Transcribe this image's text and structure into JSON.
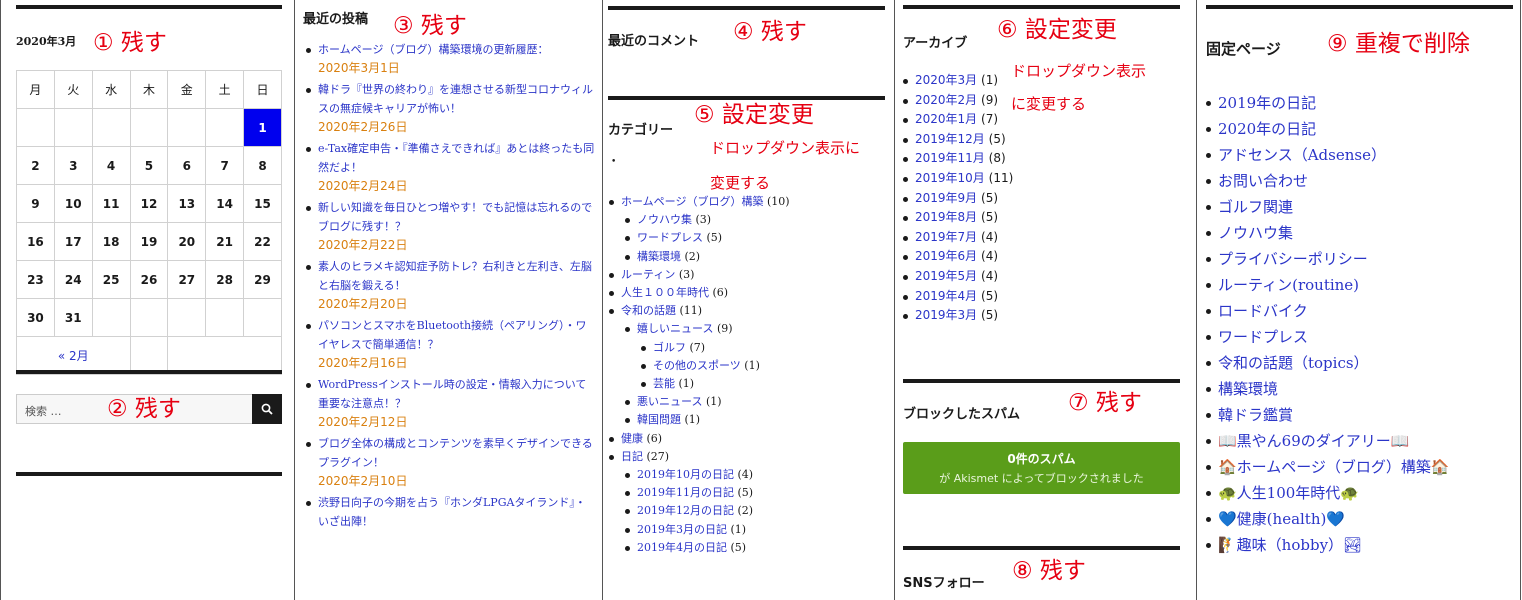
{
  "calendar": {
    "title": "2020年3月",
    "weekdays": [
      "月",
      "火",
      "水",
      "木",
      "金",
      "土",
      "日"
    ],
    "weeks": [
      [
        "",
        "",
        "",
        "",
        "",
        "",
        "1"
      ],
      [
        "2",
        "3",
        "4",
        "5",
        "6",
        "7",
        "8"
      ],
      [
        "9",
        "10",
        "11",
        "12",
        "13",
        "14",
        "15"
      ],
      [
        "16",
        "17",
        "18",
        "19",
        "20",
        "21",
        "22"
      ],
      [
        "23",
        "24",
        "25",
        "26",
        "27",
        "28",
        "29"
      ],
      [
        "30",
        "31",
        "",
        "",
        "",
        "",
        ""
      ]
    ],
    "today": "1",
    "prev_link": "« 2月"
  },
  "search": {
    "placeholder": "検索 …"
  },
  "recent_posts": {
    "title": "最近の投稿",
    "items": [
      {
        "title": "ホームページ（ブログ）構築環境の更新履歴：",
        "date": "2020年3月1日"
      },
      {
        "title": "韓ドラ『世界の終わり』を連想させる新型コロナウィルスの無症候キャリアが怖い！",
        "date": "2020年2月26日"
      },
      {
        "title": "e-Tax確定申告・『準備さえできれば』あとは終ったも同然だよ！",
        "date": "2020年2月24日"
      },
      {
        "title": "新しい知識を毎日ひとつ増やす！でも記憶は忘れるのでブログに残す！？",
        "date": "2020年2月22日"
      },
      {
        "title": "素人のヒラメキ認知症予防トレ？右利きと左利き、左脳と右脳を鍛える！",
        "date": "2020年2月20日"
      },
      {
        "title": "パソコンとスマホをBluetooth接続（ペアリング）・ワイヤレスで簡単通信！？",
        "date": "2020年2月16日"
      },
      {
        "title": "WordPressインストール時の設定・情報入力について重要な注意点！？",
        "date": "2020年2月12日"
      },
      {
        "title": "ブログ全体の構成とコンテンツを素早くデザインできるプラグイン！",
        "date": "2020年2月10日"
      },
      {
        "title": "渋野日向子の今期を占う『ホンダLPGAタイランド』・いざ出陣！",
        "date": ""
      }
    ]
  },
  "recent_comments": {
    "title": "最近のコメント"
  },
  "categories": {
    "title": "カテゴリー",
    "items": [
      {
        "label": "ホームページ（ブログ）構築",
        "count": "(10)",
        "depth": 0
      },
      {
        "label": "ノウハウ集",
        "count": "(3)",
        "depth": 1
      },
      {
        "label": "ワードプレス",
        "count": "(5)",
        "depth": 1
      },
      {
        "label": "構築環境",
        "count": "(2)",
        "depth": 1
      },
      {
        "label": "ルーティン",
        "count": "(3)",
        "depth": 0
      },
      {
        "label": "人生１００年時代",
        "count": "(6)",
        "depth": 0
      },
      {
        "label": "令和の話題",
        "count": "(11)",
        "depth": 0
      },
      {
        "label": "嬉しいニュース",
        "count": "(9)",
        "depth": 1
      },
      {
        "label": "ゴルフ",
        "count": "(7)",
        "depth": 2
      },
      {
        "label": "その他のスポーツ",
        "count": "(1)",
        "depth": 2
      },
      {
        "label": "芸能",
        "count": "(1)",
        "depth": 2
      },
      {
        "label": "悪いニュース",
        "count": "(1)",
        "depth": 1
      },
      {
        "label": "韓国問題",
        "count": "(1)",
        "depth": 1
      },
      {
        "label": "健康",
        "count": "(6)",
        "depth": 0
      },
      {
        "label": "日記",
        "count": "(27)",
        "depth": 0
      },
      {
        "label": "2019年10月の日記",
        "count": "(4)",
        "depth": 1
      },
      {
        "label": "2019年11月の日記",
        "count": "(5)",
        "depth": 1
      },
      {
        "label": "2019年12月の日記",
        "count": "(2)",
        "depth": 1
      },
      {
        "label": "2019年3月の日記",
        "count": "(1)",
        "depth": 1
      },
      {
        "label": "2019年4月の日記",
        "count": "(5)",
        "depth": 1
      }
    ]
  },
  "archives": {
    "title": "アーカイブ",
    "items": [
      {
        "label": "2020年3月",
        "count": "(1)"
      },
      {
        "label": "2020年2月",
        "count": "(9)"
      },
      {
        "label": "2020年1月",
        "count": "(7)"
      },
      {
        "label": "2019年12月",
        "count": "(5)"
      },
      {
        "label": "2019年11月",
        "count": "(8)"
      },
      {
        "label": "2019年10月",
        "count": "(11)"
      },
      {
        "label": "2019年9月",
        "count": "(5)"
      },
      {
        "label": "2019年8月",
        "count": "(5)"
      },
      {
        "label": "2019年7月",
        "count": "(4)"
      },
      {
        "label": "2019年6月",
        "count": "(4)"
      },
      {
        "label": "2019年5月",
        "count": "(4)"
      },
      {
        "label": "2019年4月",
        "count": "(5)"
      },
      {
        "label": "2019年3月",
        "count": "(5)"
      }
    ]
  },
  "spam": {
    "title": "ブロックしたスパム",
    "count": "0件のスパム",
    "sub": "が Akismet によってブロックされました"
  },
  "sns": {
    "title": "SNSフォロー"
  },
  "pages": {
    "title": "固定ページ",
    "items": [
      "2019年の日記",
      "2020年の日記",
      "アドセンス（Adsense）",
      "お問い合わせ",
      "ゴルフ関連",
      "ノウハウ集",
      "プライバシーポリシー",
      "ルーティン(routine)",
      "ロードバイク",
      "ワードプレス",
      "令和の話題（topics）",
      "構築環境",
      "韓ドラ鑑賞",
      "📖黒やん69のダイアリー📖",
      "🏠ホームページ（ブログ）構築🏠",
      "🐢人生100年時代🐢",
      "💙健康(health)💙",
      "🧗趣味（hobby）🏞"
    ]
  },
  "annotations": {
    "n1": "① 残す",
    "n2": "② 残す",
    "n3": "③ 残す",
    "n4": "④ 残す",
    "n5": "⑤ 設定変更",
    "n5_sub1": "ドロップダウン表示に",
    "n5_sub2": "変更する",
    "n6": "⑥ 設定変更",
    "n6_sub1": "ドロップダウン表示",
    "n6_sub2": "に変更する",
    "n7": "⑦ 残す",
    "n8": "⑧ 残す",
    "n9": "⑨ 重複で削除"
  }
}
